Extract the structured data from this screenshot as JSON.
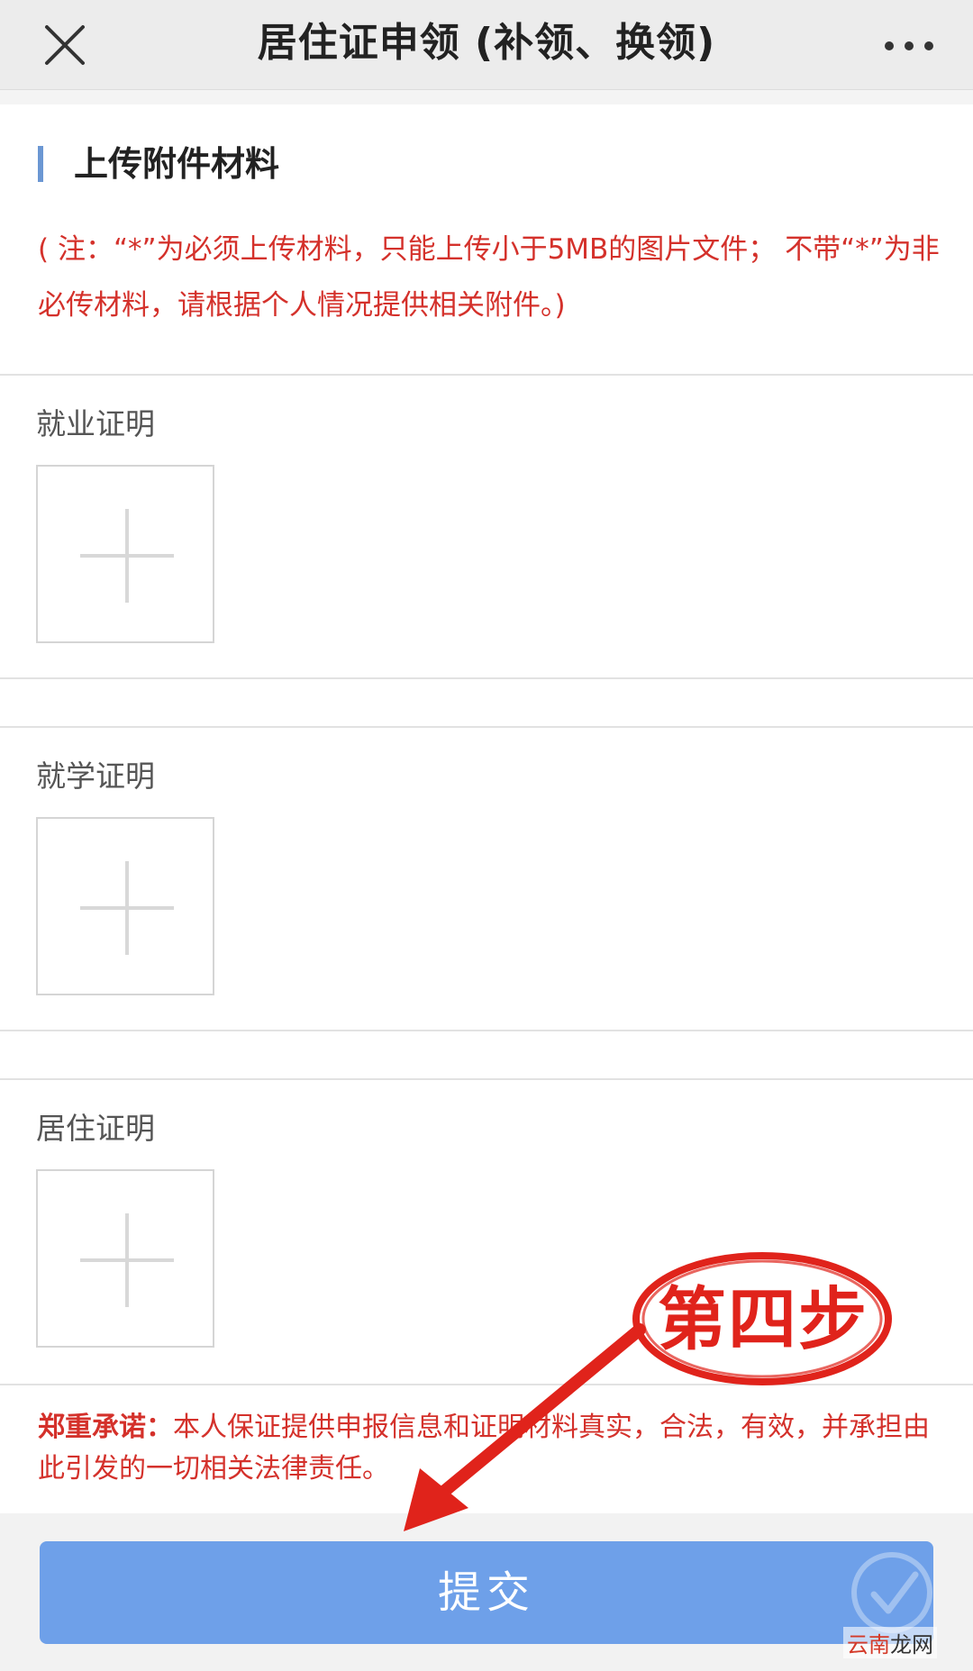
{
  "navbar": {
    "title": "居住证申领 (补领、换领)",
    "close_icon": "close-icon",
    "more_icon": "more-dots-icon"
  },
  "section": {
    "title": "上传附件材料",
    "note": "( 注：“*”为必须上传材料，只能上传小于5MB的图片文件； 不带“*”为非必传材料，请根据个人情况提供相关附件。)"
  },
  "uploads": [
    {
      "label": "就业证明",
      "icon": "plus-icon"
    },
    {
      "label": "就学证明",
      "icon": "plus-icon"
    },
    {
      "label": "居住证明",
      "icon": "plus-icon"
    }
  ],
  "pledge": {
    "label": "郑重承诺：",
    "text": "本人保证提供申报信息和证明材料真实，合法，有效，并承担由此引发的一切相关法律责任。"
  },
  "submit": {
    "label": "提交"
  },
  "annotation": {
    "step_label": "第四步",
    "color": "#e0231b"
  },
  "watermark": {
    "part1": "云南",
    "part2": "龙网"
  },
  "colors": {
    "accent": "#6b97d3",
    "warning": "#d4312b",
    "button": "#6ea0e9"
  }
}
